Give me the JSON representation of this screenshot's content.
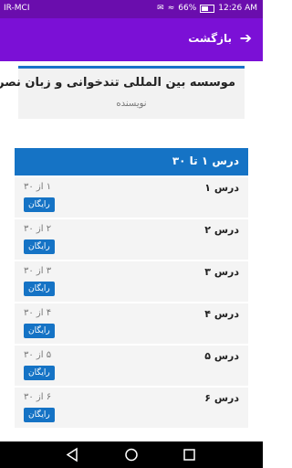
{
  "status": {
    "carrier": "IR-MCI",
    "battery": "66%",
    "time": "12:26 AM"
  },
  "appbar": {
    "back_label": "بازگشت"
  },
  "book": {
    "title": "موسسه بین المللی تندخوانی و زبان نصرت",
    "author": "نویسنده"
  },
  "section": {
    "title": "درس ۱ تا ۳۰"
  },
  "lessons": [
    {
      "name": "درس ۱",
      "count": "۱ از ۳۰",
      "badge": "رایگان"
    },
    {
      "name": "درس ۲",
      "count": "۲ از ۳۰",
      "badge": "رایگان"
    },
    {
      "name": "درس ۳",
      "count": "۳ از ۳۰",
      "badge": "رایگان"
    },
    {
      "name": "درس ۴",
      "count": "۴ از ۳۰",
      "badge": "رایگان"
    },
    {
      "name": "درس ۵",
      "count": "۵ از ۳۰",
      "badge": "رایگان"
    },
    {
      "name": "درس ۶",
      "count": "۶ از ۳۰",
      "badge": "رایگان"
    }
  ],
  "colors": {
    "appbar": "#7b10d6",
    "accent": "#1573c5"
  },
  "icons": {
    "back": "arrow-right-icon",
    "nav_back": "triangle-back-icon",
    "nav_home": "circle-home-icon",
    "nav_recent": "square-recent-icon"
  }
}
